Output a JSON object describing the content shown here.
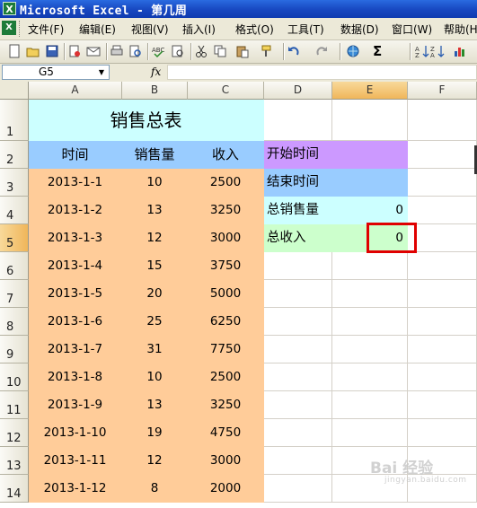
{
  "window": {
    "title": "Microsoft Excel - 第几周",
    "app_icon": "excel-icon"
  },
  "menu": {
    "items": [
      {
        "label": "文件(F)"
      },
      {
        "label": "编辑(E)"
      },
      {
        "label": "视图(V)"
      },
      {
        "label": "插入(I)"
      },
      {
        "label": "格式(O)"
      },
      {
        "label": "工具(T)"
      },
      {
        "label": "数据(D)"
      },
      {
        "label": "窗口(W)"
      },
      {
        "label": "帮助(H)"
      }
    ]
  },
  "toolbar": {
    "buttons": [
      "new-icon",
      "open-icon",
      "save-icon",
      "permission-icon",
      "email-icon",
      "print-icon",
      "print-preview-icon",
      "spelling-icon",
      "research-icon",
      "cut-icon",
      "copy-icon",
      "paste-icon",
      "format-painter-icon",
      "undo-icon",
      "redo-icon",
      "hyperlink-icon",
      "autosum-icon",
      "sort-ascending-icon",
      "sort-descending-icon",
      "chart-icon"
    ],
    "autosum_label": "Σ"
  },
  "formula_bar": {
    "name_box": "G5",
    "fx_label": "fx",
    "formula": ""
  },
  "sheet": {
    "columns": [
      "A",
      "B",
      "C",
      "D",
      "E",
      "F"
    ],
    "active_cell": "E5",
    "title": "销售总表",
    "headers": [
      "时间",
      "销售量",
      "收入"
    ],
    "rows": [
      {
        "num": "3",
        "date": "2013-1-1",
        "qty": "10",
        "income": "2500"
      },
      {
        "num": "4",
        "date": "2013-1-2",
        "qty": "13",
        "income": "3250"
      },
      {
        "num": "5",
        "date": "2013-1-3",
        "qty": "12",
        "income": "3000"
      },
      {
        "num": "6",
        "date": "2013-1-4",
        "qty": "15",
        "income": "3750"
      },
      {
        "num": "7",
        "date": "2013-1-5",
        "qty": "20",
        "income": "5000"
      },
      {
        "num": "8",
        "date": "2013-1-6",
        "qty": "25",
        "income": "6250"
      },
      {
        "num": "9",
        "date": "2013-1-7",
        "qty": "31",
        "income": "7750"
      },
      {
        "num": "10",
        "date": "2013-1-8",
        "qty": "10",
        "income": "2500"
      },
      {
        "num": "11",
        "date": "2013-1-9",
        "qty": "13",
        "income": "3250"
      },
      {
        "num": "12",
        "date": "2013-1-10",
        "qty": "19",
        "income": "4750"
      },
      {
        "num": "13",
        "date": "2013-1-11",
        "qty": "12",
        "income": "3000"
      },
      {
        "num": "14",
        "date": "2013-1-12",
        "qty": "8",
        "income": "2000"
      }
    ],
    "summary": {
      "start_label": "开始时间",
      "end_label": "结束时间",
      "total_qty_label": "总销售量",
      "total_qty_value": "0",
      "total_income_label": "总收入",
      "total_income_value": "0"
    },
    "colors": {
      "title_fill": "#ccffff",
      "header_fill": "#99ccff",
      "data_fill": "#ffcc99",
      "start_fill": "#cc99ff",
      "end_fill": "#99ccff",
      "total_qty_fill": "#ccffff",
      "total_income_fill": "#ccffcc",
      "selection_border": "#e00000"
    }
  },
  "watermark": {
    "text": "Bai 经验",
    "sub": "jingyan.baidu.com"
  }
}
